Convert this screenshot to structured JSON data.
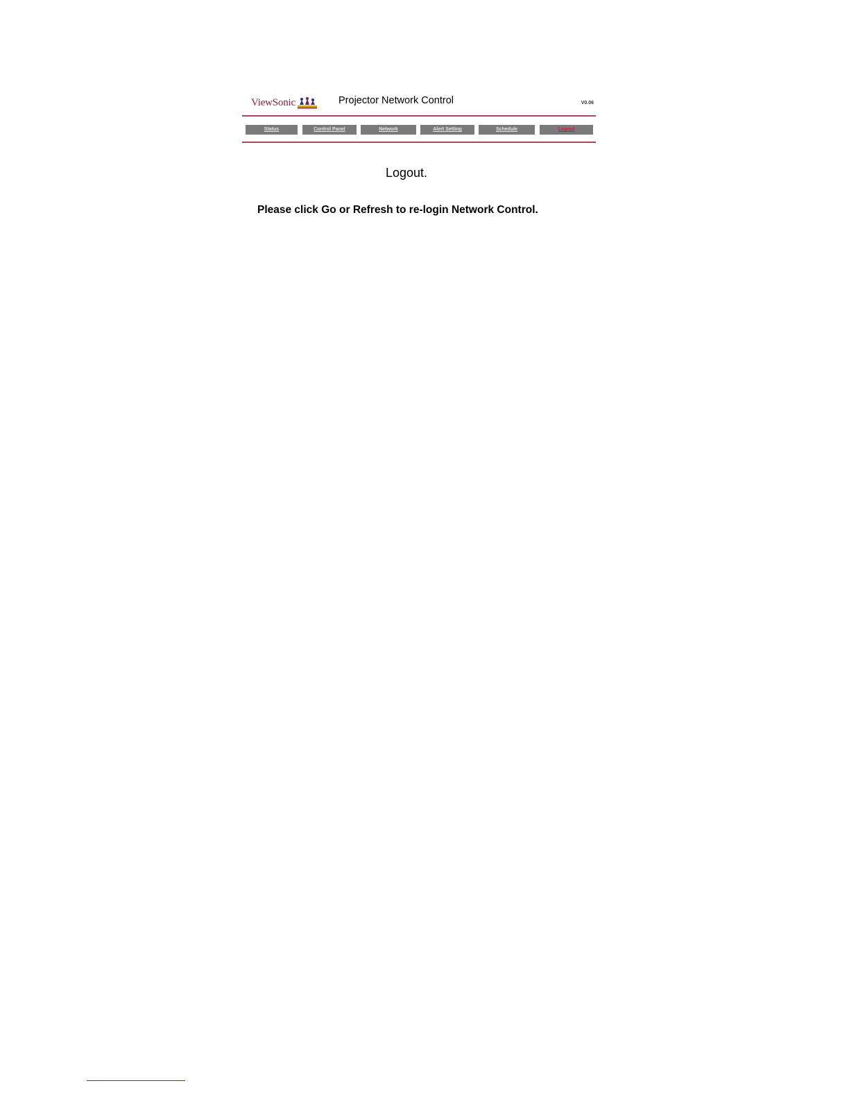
{
  "header": {
    "brand": "ViewSonic",
    "title": "Projector Network Control",
    "version": "V0.06"
  },
  "nav": {
    "items": [
      {
        "label": "Status"
      },
      {
        "label": "Control Panel"
      },
      {
        "label": "Network"
      },
      {
        "label": "Alert Setting"
      },
      {
        "label": "Schedule"
      },
      {
        "label": "Logout"
      }
    ],
    "active": "Logout"
  },
  "main": {
    "heading": "Logout.",
    "message": "Please click Go or Refresh to re-login Network Control."
  },
  "colors": {
    "brand": "#9b1b3e",
    "rule": "#a8475f",
    "nav_bg": "#7a7a7a",
    "nav_active_text": "#d01a2c"
  }
}
